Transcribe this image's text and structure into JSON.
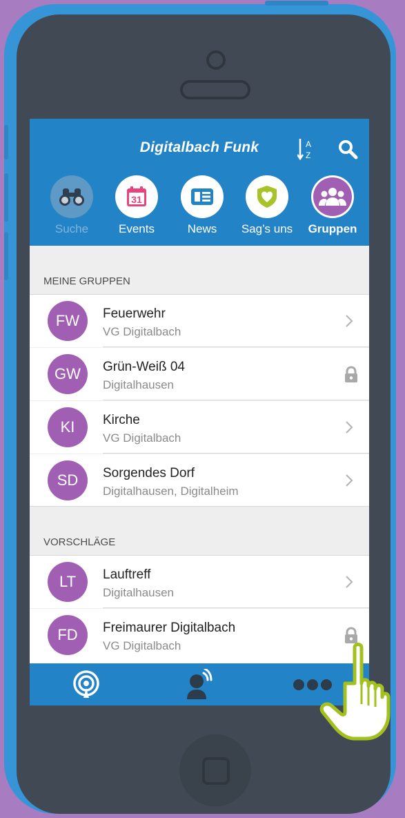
{
  "header": {
    "title": "Digitalbach Funk"
  },
  "nav": [
    {
      "key": "suche",
      "label": "Suche",
      "icon": "binoculars-icon"
    },
    {
      "key": "events",
      "label": "Events",
      "icon": "calendar-icon",
      "day": "31"
    },
    {
      "key": "news",
      "label": "News",
      "icon": "newspaper-icon"
    },
    {
      "key": "sags",
      "label": "Sag’s uns",
      "icon": "heart-shield-icon"
    },
    {
      "key": "gruppen",
      "label": "Gruppen",
      "icon": "group-icon"
    }
  ],
  "sections": {
    "mine": {
      "title": "MEINE GRUPPEN",
      "rows": [
        {
          "initials": "FW",
          "title": "Feuerwehr",
          "subtitle": "VG Digitalbach",
          "action": "chevron"
        },
        {
          "initials": "GW",
          "title": "Grün-Weiß 04",
          "subtitle": "Digitalhausen",
          "action": "lock"
        },
        {
          "initials": "KI",
          "title": "Kirche",
          "subtitle": "VG Digitalbach",
          "action": "chevron"
        },
        {
          "initials": "SD",
          "title": "Sorgendes Dorf",
          "subtitle": "Digitalhausen, Digitalheim",
          "action": "chevron"
        }
      ]
    },
    "suggestions": {
      "title": "VORSCHLÄGE",
      "rows": [
        {
          "initials": "LT",
          "title": "Lauftreff",
          "subtitle": "Digitalhausen",
          "action": "chevron"
        },
        {
          "initials": "FD",
          "title": "Freimaurer Digitalbach",
          "subtitle": "VG Digitalbach",
          "action": "lock"
        }
      ]
    }
  },
  "tabbar": [
    {
      "icon": "broadcast-icon"
    },
    {
      "icon": "speaker-person-icon"
    },
    {
      "icon": "more-icon"
    }
  ],
  "colors": {
    "background": "#a77cc0",
    "phone_frame": "#3595d6",
    "phone_body": "#414a54",
    "app_blue": "#2383c7",
    "avatar_purple": "#a15fb4",
    "hand_outline": "#a2c01e"
  }
}
